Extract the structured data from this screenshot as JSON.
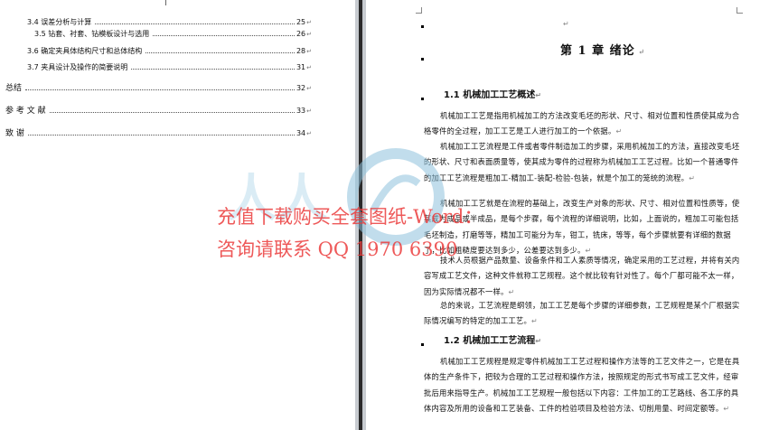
{
  "toc": {
    "entries": [
      {
        "title": "3.4 误差分析与计算",
        "page": "25"
      },
      {
        "title": "3.5 钻套、衬套、钻模板设计与选用",
        "page": "26"
      },
      {
        "title": "3.6 确定夹具体结构尺寸和总体结构",
        "page": "28"
      },
      {
        "title": "3.7 夹具设计及操作的简要说明",
        "page": "31"
      },
      {
        "title": "总结",
        "page": "32"
      },
      {
        "title": "参 考 文 献",
        "page": "33"
      },
      {
        "title": "致    谢",
        "page": "34"
      }
    ]
  },
  "document": {
    "chapter_title": "第 1 章  绪论",
    "section_1_1": "1.1  机械加工工艺概述",
    "para_1": "机械加工工艺是指用机械加工的方法改变毛坯的形状、尺寸、相对位置和性质使其成为合格零件的全过程，加工工艺是工人进行加工的一个依据。",
    "para_2": "机械加工工艺流程是工件或者零件制造加工的步骤，采用机械加工的方法，直接改变毛坯的形状、尺寸和表面质量等，使其成为零件的过程称为机械加工工艺过程。比如一个普通零件的加工工艺流程是粗加工-精加工-装配-检验-包装，就是个加工的笼统的流程。",
    "para_3": "机械加工工艺就是在流程的基础上，改变生产对象的形状、尺寸、相对位置和性质等，使其成为成品或半成品，是每个步骤，每个流程的详细说明，比如，上面说的，粗加工可能包括毛坯制造，打磨等等，精加工可能分为车，钳工，铣床，等等，每个步骤就要有详细的数据了，比如粗糙度要达到多少，公差要达到多少。",
    "para_4": "技术人员根据产品数量、设备条件和工人素质等情况，确定采用的工艺过程，并将有关内容写成工艺文件，这种文件就称工艺规程。这个就比较有针对性了。每个厂都可能不太一样，因为实际情况都不一样。",
    "para_5": "总的来说，工艺流程是纲领，加工工艺是每个步骤的详细参数，工艺规程是某个厂根据实际情况编写的特定的加工工艺。",
    "section_1_2": "1.2 机械加工工艺流程",
    "para_6": "机械加工工艺规程是规定零件机械加工工艺过程和操作方法等的工艺文件之一，它是在具体的生产条件下，把较为合理的工艺过程和操作方法，按照规定的形式书写成工艺文件，经审批后用来指导生产。机械加工工艺规程一般包括以下内容：工件加工的工艺路线、各工序的具体内容及所用的设备和工艺装备、工件的检验项目及检验方法、切削用量、时间定额等。"
  },
  "watermark": {
    "line_1": "充值下载购买全套图纸-Word：",
    "line_2": "咨询请联系 QQ 1970 6390"
  }
}
